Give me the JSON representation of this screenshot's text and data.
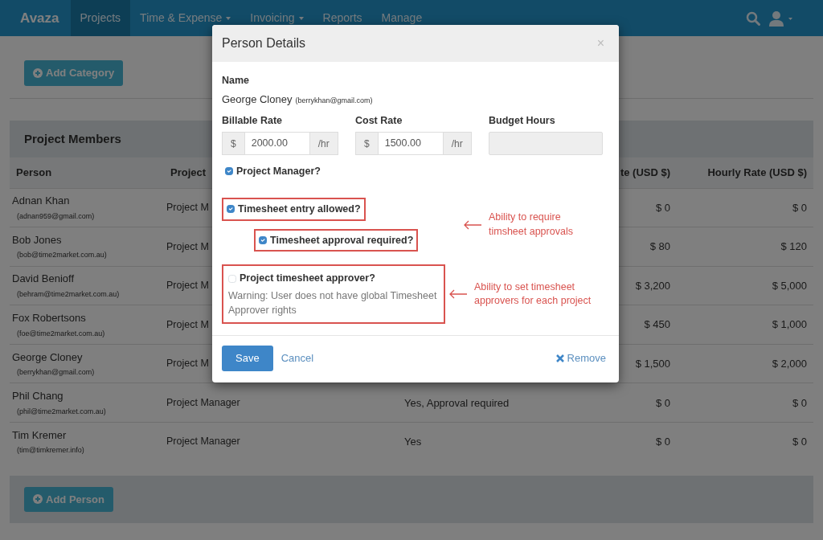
{
  "navbar": {
    "brand": "Avaza",
    "items": [
      {
        "label": "Projects",
        "selected": true,
        "dropdown": false
      },
      {
        "label": "Time & Expense",
        "selected": false,
        "dropdown": true
      },
      {
        "label": "Invoicing",
        "selected": false,
        "dropdown": true
      },
      {
        "label": "Reports",
        "selected": false,
        "dropdown": false
      },
      {
        "label": "Manage",
        "selected": false,
        "dropdown": false
      }
    ]
  },
  "categories": {
    "add_button": "Add Category"
  },
  "members": {
    "title": "Project Members",
    "columns": {
      "person": "Person",
      "role": "Project",
      "column_4": "te (USD $)",
      "hourly_rate": "Hourly Rate (USD $)"
    },
    "rows": [
      {
        "name": "Adnan Khan",
        "email": "(adnan959@gmail.com)",
        "role": "Project M",
        "rate": "$ 0",
        "hourly_rate": "$ 0"
      },
      {
        "name": "Bob Jones",
        "email": "(bob@time2market.com.au)",
        "role": "Project M",
        "rate": "$ 80",
        "hourly_rate": "$ 120"
      },
      {
        "name": "David Benioff",
        "email": "(behram@time2market.com.au)",
        "role": "Project M",
        "rate": "$ 3,200",
        "hourly_rate": "$ 5,000"
      },
      {
        "name": "Fox Robertsons",
        "email": "(foe@time2market.com.au)",
        "role": "Project M",
        "rate": "$ 450",
        "hourly_rate": "$ 1,000"
      },
      {
        "name": "George Cloney",
        "email": "(berrykhan@gmail.com)",
        "role": "Project M",
        "rate": "$ 1,500",
        "hourly_rate": "$ 2,000"
      },
      {
        "name": "Phil Chang",
        "email": "(phil@time2market.com.au)",
        "role": "Project Manager",
        "timesheet": "Yes, Approval required",
        "rate": "$ 0",
        "hourly_rate": "$ 0"
      },
      {
        "name": "Tim Kremer",
        "email": "(tim@timkremer.info)",
        "role": "Project Manager",
        "timesheet": "Yes",
        "rate": "$ 0",
        "hourly_rate": "$ 0"
      }
    ],
    "add_button": "Add Person"
  },
  "modal": {
    "title": "Person Details",
    "close": "×",
    "name_label": "Name",
    "name": "George Cloney",
    "email": "(berrykhan@gmail.com)",
    "rates": [
      {
        "label": "Billable Rate",
        "prefix": "$",
        "value": "2000.00",
        "suffix": "/hr",
        "disabled": false
      },
      {
        "label": "Cost Rate",
        "prefix": "$",
        "value": "1500.00",
        "suffix": "/hr",
        "disabled": false
      },
      {
        "label": "Budget Hours",
        "disabled": true
      }
    ],
    "options": [
      {
        "label": "Project Manager?",
        "checked": true,
        "highlighted": false
      },
      {
        "label": "Timesheet entry allowed?",
        "checked": true,
        "highlighted": true,
        "annotation": "Ability to require\ntimsheet approvals",
        "children": [
          {
            "label": "Timesheet approval required?",
            "checked": true,
            "highlighted": true
          }
        ]
      },
      {
        "label": "Project timesheet approver?",
        "checked": false,
        "highlighted": true,
        "warning": "Warning: User does not have global Timesheet Approver rights",
        "annotation": "Ability to set timesheet\napprovers for each project"
      }
    ],
    "save": "Save",
    "cancel": "Cancel",
    "remove": "Remove"
  }
}
